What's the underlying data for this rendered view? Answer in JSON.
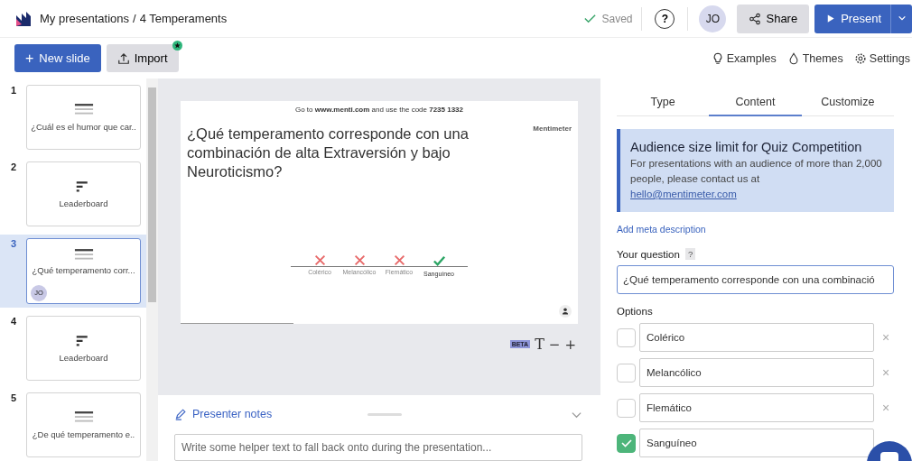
{
  "header": {
    "breadcrumb_root": "My presentations",
    "separator": "/",
    "title": "4 Temperaments",
    "saved": "Saved",
    "help": "?",
    "avatar": "JO",
    "share": "Share",
    "present": "Present"
  },
  "toolbar": {
    "new_slide_glyph": "+",
    "new_slide": "New slide",
    "import": "Import",
    "links": [
      {
        "kind": "examples",
        "label": "Examples"
      },
      {
        "kind": "themes",
        "label": "Themes"
      },
      {
        "kind": "settings",
        "label": "Settings"
      }
    ]
  },
  "slides": [
    {
      "number": "1",
      "kind": "question",
      "label": "¿Cuál es el humor que car..",
      "selected": false
    },
    {
      "number": "2",
      "kind": "leaderboard",
      "label": "Leaderboard",
      "selected": false
    },
    {
      "number": "3",
      "kind": "question",
      "label": "¿Qué temperamento corr...",
      "selected": true,
      "avatar": "JO"
    },
    {
      "number": "4",
      "kind": "leaderboard",
      "label": "Leaderboard",
      "selected": false
    },
    {
      "number": "5",
      "kind": "question",
      "label": "¿De qué temperamento e..",
      "selected": false
    }
  ],
  "preview": {
    "instruction": "Go to **www.menti.com** and use the code **7235 1332**",
    "logo": "Mentimeter",
    "question": "¿Qué temperamento corresponde con una combinación de alta Extraversión y bajo Neuroticismo?",
    "answers": [
      {
        "label": "Colérico",
        "correct": false
      },
      {
        "label": "Melancólico",
        "correct": false
      },
      {
        "label": "Flemático",
        "correct": false
      },
      {
        "label": "Sanguíneo",
        "correct": true
      }
    ],
    "beta": "BETA",
    "font_glyph": "T",
    "minus": "−",
    "plus": "+"
  },
  "notes": {
    "title": "Presenter notes",
    "placeholder": "Write some helper text to fall back onto during the presentation..."
  },
  "panel": {
    "tabs": [
      {
        "label": "Type",
        "selected": false
      },
      {
        "label": "Content",
        "selected": true
      },
      {
        "label": "Customize",
        "selected": false
      }
    ],
    "info": {
      "title": "Audience size limit for Quiz Competition",
      "body": "For presentations with an audience of more than 2,000 people, please contact us at",
      "email": "hello@mentimeter.com"
    },
    "meta_link": "Add meta description",
    "question_label": "Your question",
    "question_help": "?",
    "question_value": "¿Qué temperamento corresponde con una combinació",
    "options_label": "Options",
    "options": [
      {
        "value": "Colérico",
        "checked": false,
        "removable": true
      },
      {
        "value": "Melancólico",
        "checked": false,
        "removable": true
      },
      {
        "value": "Flemático",
        "checked": false,
        "removable": true
      },
      {
        "value": "Sanguíneo",
        "checked": true,
        "removable": false
      }
    ],
    "remove_glyph": "×"
  }
}
